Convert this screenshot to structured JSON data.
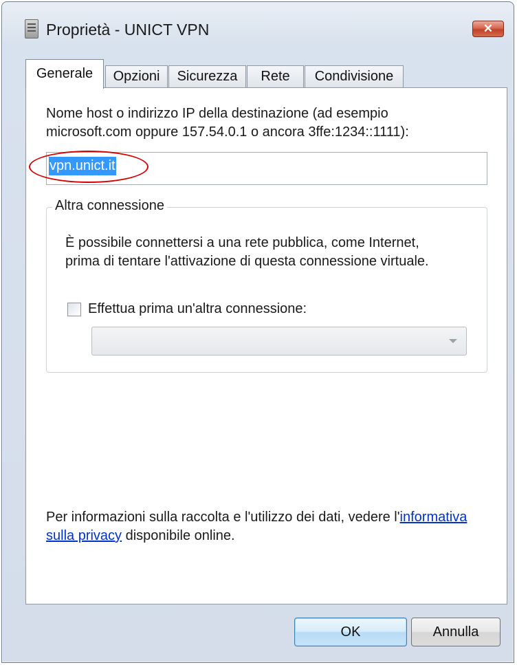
{
  "window": {
    "title": "Proprietà - UNICT VPN",
    "close_label": "✕",
    "title_icon": "document-icon"
  },
  "tabs": [
    {
      "label": "Generale",
      "active": true
    },
    {
      "label": "Opzioni",
      "active": false
    },
    {
      "label": "Sicurezza",
      "active": false
    },
    {
      "label": "Rete",
      "active": false
    },
    {
      "label": "Condivisione",
      "active": false
    }
  ],
  "general": {
    "host_label_line1": "Nome host o indirizzo IP della destinazione (ad esempio",
    "host_label_line2": "microsoft.com oppure 157.54.0.1 o ancora 3ffe:1234::1111):",
    "host_value": "vpn.unict.it",
    "group_title": "Altra connessione",
    "group_text_line1": "È possibile connettersi a una rete pubblica, come Internet,",
    "group_text_line2": "prima di tentare l'attivazione di questa connessione virtuale.",
    "checkbox_label": "Effettua prima un'altra connessione:",
    "checkbox_checked": false,
    "combo_value": "",
    "privacy_pre": "Per informazioni sulla raccolta e l'utilizzo dei dati, vedere l'",
    "privacy_link_1": "informativa",
    "privacy_link_2": "sulla privacy",
    "privacy_post": " disponibile online."
  },
  "buttons": {
    "ok": "OK",
    "cancel": "Annulla"
  },
  "colors": {
    "selection": "#3399ff",
    "annotation": "#d60000",
    "link": "#0033cc",
    "close_button": "#c0432a"
  }
}
